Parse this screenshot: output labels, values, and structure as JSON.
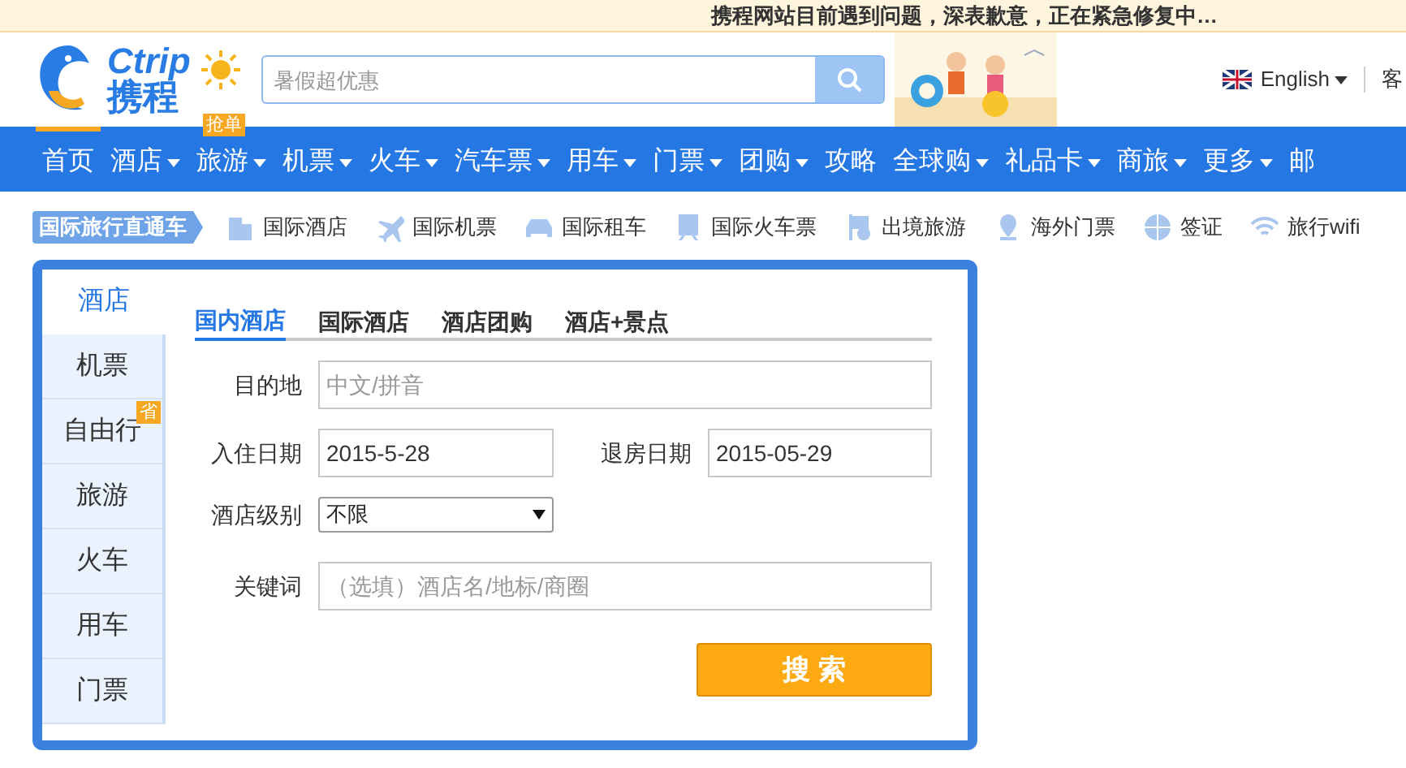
{
  "notice": "携程网站目前遇到问题，深表歉意，正在紧急修复中…",
  "header": {
    "logo_latin": "Ctrip",
    "logo_cn": "携程",
    "search": {
      "placeholder": "暑假超优惠"
    },
    "language": "English",
    "service": "客"
  },
  "nav": [
    {
      "label": "首页",
      "dropdown": false,
      "selected": true
    },
    {
      "label": "酒店",
      "dropdown": true,
      "selected": false
    },
    {
      "label": "旅游",
      "dropdown": true,
      "selected": false,
      "badge": "抢单"
    },
    {
      "label": "机票",
      "dropdown": true,
      "selected": false
    },
    {
      "label": "火车",
      "dropdown": true,
      "selected": false
    },
    {
      "label": "汽车票",
      "dropdown": true,
      "selected": false
    },
    {
      "label": "用车",
      "dropdown": true,
      "selected": false
    },
    {
      "label": "门票",
      "dropdown": true,
      "selected": false
    },
    {
      "label": "团购",
      "dropdown": true,
      "selected": false
    },
    {
      "label": "攻略",
      "dropdown": false,
      "selected": false
    },
    {
      "label": "全球购",
      "dropdown": true,
      "selected": false
    },
    {
      "label": "礼品卡",
      "dropdown": true,
      "selected": false
    },
    {
      "label": "商旅",
      "dropdown": true,
      "selected": false
    },
    {
      "label": "更多",
      "dropdown": true,
      "selected": false
    },
    {
      "label": "邮",
      "dropdown": false,
      "selected": false
    }
  ],
  "intl_bar": {
    "title": "国际旅行直通车",
    "items": [
      {
        "label": "国际酒店",
        "kind": "building"
      },
      {
        "label": "国际机票",
        "kind": "plane"
      },
      {
        "label": "国际租车",
        "kind": "car"
      },
      {
        "label": "国际火车票",
        "kind": "train"
      },
      {
        "label": "出境旅游",
        "kind": "flag"
      },
      {
        "label": "海外门票",
        "kind": "pin"
      },
      {
        "label": "签证",
        "kind": "globe"
      },
      {
        "label": "旅行wifi",
        "kind": "wifi"
      }
    ]
  },
  "side_tabs": [
    {
      "label": "酒店",
      "selected": true
    },
    {
      "label": "机票",
      "selected": false
    },
    {
      "label": "自由行",
      "selected": false,
      "badge": "省"
    },
    {
      "label": "旅游",
      "selected": false
    },
    {
      "label": "火车",
      "selected": false
    },
    {
      "label": "用车",
      "selected": false
    },
    {
      "label": "门票",
      "selected": false
    }
  ],
  "hotel_tabs": [
    {
      "label": "国内酒店",
      "selected": true
    },
    {
      "label": "国际酒店",
      "selected": false
    },
    {
      "label": "酒店团购",
      "selected": false
    },
    {
      "label": "酒店+景点",
      "selected": false
    }
  ],
  "form": {
    "destination": {
      "label": "目的地",
      "placeholder": "中文/拼音"
    },
    "checkin": {
      "label": "入住日期",
      "value": "2015-5-28"
    },
    "checkout": {
      "label": "退房日期",
      "value": "2015-05-29"
    },
    "star": {
      "label": "酒店级别",
      "value": "不限"
    },
    "keyword": {
      "label": "关键词",
      "placeholder": "（选填）酒店名/地标/商圈"
    },
    "submit": "搜 索"
  }
}
